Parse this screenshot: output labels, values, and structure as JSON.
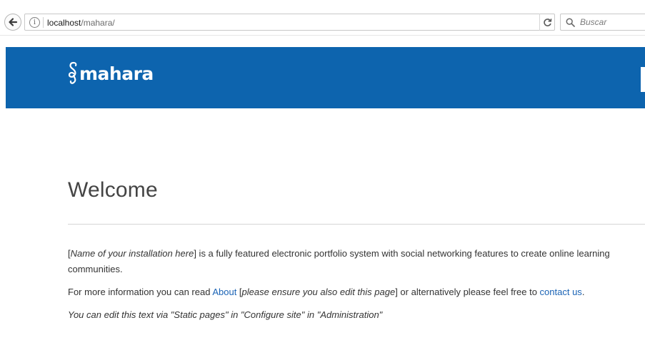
{
  "browser": {
    "url_host": "localhost",
    "url_path": "/mahara/",
    "search_placeholder": "Buscar"
  },
  "site": {
    "logo_text": "mahara",
    "brand_color": "#0d64ae"
  },
  "page": {
    "title": "Welcome",
    "p1_open": "[",
    "p1_em": "Name of your installation here",
    "p1_rest": "] is a fully featured electronic portfolio system with social networking features to create online learning communities.",
    "p2_prefix": "For more information you can read ",
    "p2_about_link": "About",
    "p2_mid_open": " [",
    "p2_em": "please ensure you also edit this page",
    "p2_mid_close": "] or alternatively please feel free to ",
    "p2_contact_link": "contact us",
    "p2_suffix": ".",
    "p3": "You can edit this text via \"Static pages\" in \"Configure site\" in \"Administration\""
  },
  "icons": {
    "back": "back-arrow-icon",
    "info": "info-icon",
    "reload": "reload-icon",
    "search": "search-icon",
    "logo": "mahara-logo-icon"
  }
}
